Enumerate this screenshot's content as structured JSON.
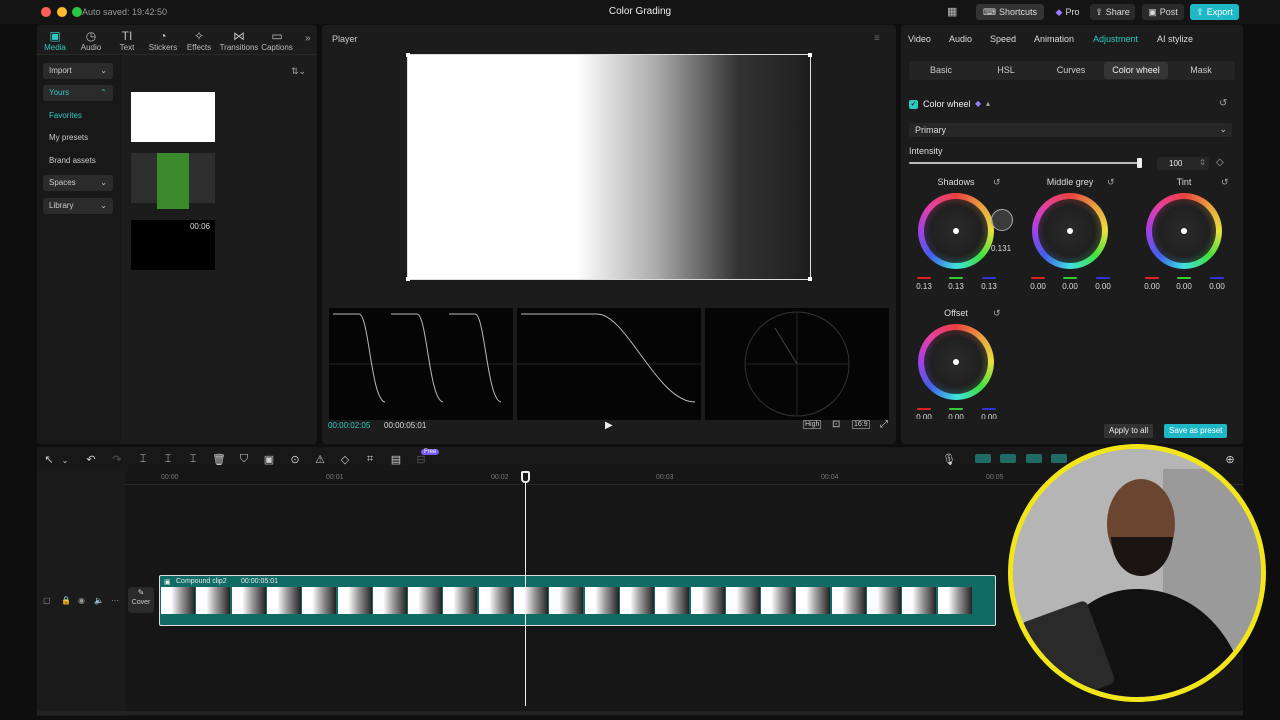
{
  "titlebar": {
    "autosave": "Auto saved: 19:42:50",
    "title": "Color Grading",
    "shortcuts": "Shortcuts",
    "pro": "Pro",
    "share": "Share",
    "post": "Post",
    "export": "Export"
  },
  "toolbar": {
    "media": "Media",
    "audio": "Audio",
    "text": "Text",
    "stickers": "Stickers",
    "effects": "Effects",
    "transitions": "Transitions",
    "captions": "Captions"
  },
  "sidebar": {
    "import": "Import",
    "yours": "Yours",
    "favorites": "Favorites",
    "my_presets": "My presets",
    "brand_assets": "Brand assets",
    "spaces": "Spaces",
    "library": "Library"
  },
  "media": {
    "clip3_duration": "00:06"
  },
  "player": {
    "title": "Player",
    "current_time": "00:00:02:05",
    "total_time": "00:00:05:01",
    "quality": "High",
    "ratio": "16:9"
  },
  "adjust": {
    "tabs": [
      "Video",
      "Audio",
      "Speed",
      "Animation",
      "Adjustment",
      "AI stylize"
    ],
    "subtabs": [
      "Basic",
      "HSL",
      "Curves",
      "Color wheel",
      "Mask"
    ],
    "section": "Color wheel",
    "mode": "Primary",
    "intensity_label": "Intensity",
    "intensity_value": "100",
    "intensity": 100,
    "wheels": {
      "shadows": {
        "label": "Shadows",
        "r": "0.13",
        "g": "0.13",
        "b": "0.13",
        "tooltip": "0.131"
      },
      "midgrey": {
        "label": "Middle grey",
        "r": "0.00",
        "g": "0.00",
        "b": "0.00"
      },
      "tint": {
        "label": "Tint",
        "r": "0.00",
        "g": "0.00",
        "b": "0.00"
      },
      "offset": {
        "label": "Offset",
        "r": "0.00",
        "g": "0.00",
        "b": "0.00"
      }
    },
    "apply_all": "Apply to all",
    "save_preset": "Save as preset"
  },
  "timeline": {
    "free_badge": "Free",
    "ruler": [
      "00:00",
      "00:01",
      "00:02",
      "00:03",
      "00:04",
      "00:05"
    ],
    "clip_name": "Compound clip2",
    "clip_duration": "00:00:05:01",
    "cover": "Cover"
  },
  "colors": {
    "accent": "#2ec8c0",
    "export": "#1fb8c6",
    "clip": "#0f6b63",
    "pro": "#9b7cff"
  }
}
